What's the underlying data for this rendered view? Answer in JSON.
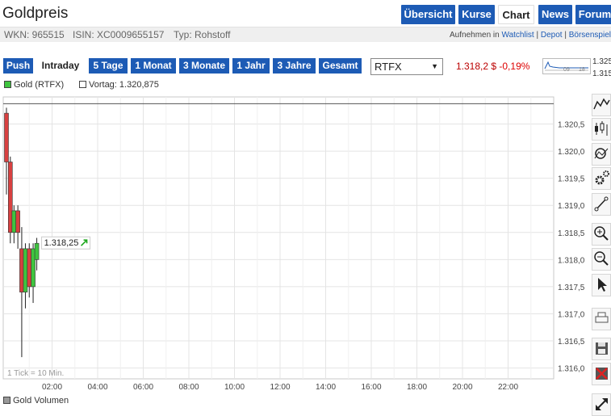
{
  "header": {
    "title": "Goldpreis",
    "tabs": [
      {
        "label": "Übersicht"
      },
      {
        "label": "Kurse"
      },
      {
        "label": "Chart"
      },
      {
        "label": "News"
      },
      {
        "label": "Forum"
      }
    ]
  },
  "info": {
    "wkn": "WKN: 965515",
    "isin": "ISIN: XC0009655157",
    "typ": "Typ: Rohstoff",
    "aufnehmen": "Aufnehmen in",
    "watchlist": "Watchlist",
    "sep1": "|",
    "depot": "Depot",
    "sep2": "|",
    "boersenspiel": "Börsenspiel"
  },
  "toolbar": {
    "ranges": [
      "Push",
      "Intraday",
      "5 Tage",
      "1 Monat",
      "3 Monate",
      "1 Jahr",
      "3 Jahre",
      "Gesamt"
    ],
    "exchange": "RTFX",
    "price": "1.318,2 $",
    "change": "-0,19%",
    "mini_labels": [
      "09",
      "18"
    ],
    "mini_values": [
      "1.325",
      "1.315"
    ]
  },
  "legend": {
    "gold": "Gold (RTFX)",
    "vortag": "Vortag: 1.320,875"
  },
  "chart_data": {
    "type": "candlestick",
    "y_ticks": [
      "1.320,5",
      "1.320,0",
      "1.319,5",
      "1.319,0",
      "1.318,5",
      "1.318,0",
      "1.317,5",
      "1.317,0",
      "1.316,5",
      "1.316,0"
    ],
    "y_tick_values": [
      1320.5,
      1320.0,
      1319.5,
      1319.0,
      1318.5,
      1318.0,
      1317.5,
      1317.0,
      1316.5,
      1316.0
    ],
    "x_ticks": [
      "02:00",
      "04:00",
      "06:00",
      "08:00",
      "10:00",
      "12:00",
      "14:00",
      "16:00",
      "18:00",
      "20:00",
      "22:00"
    ],
    "x_tick_hours": [
      2,
      4,
      6,
      8,
      10,
      12,
      14,
      16,
      18,
      20,
      22
    ],
    "ylim": [
      1315.8,
      1321.0
    ],
    "xlim_hours": [
      0.0,
      24.0
    ],
    "candles": [
      {
        "t": 0.0,
        "open": 1320.7,
        "high": 1320.8,
        "low": 1319.2,
        "close": 1319.8
      },
      {
        "t": 0.17,
        "open": 1319.8,
        "high": 1319.9,
        "low": 1318.3,
        "close": 1318.5
      },
      {
        "t": 0.33,
        "open": 1318.5,
        "high": 1319.0,
        "low": 1318.3,
        "close": 1318.9
      },
      {
        "t": 0.5,
        "open": 1318.9,
        "high": 1319.0,
        "low": 1318.2,
        "close": 1318.5
      },
      {
        "t": 0.67,
        "open": 1318.2,
        "high": 1318.6,
        "low": 1316.2,
        "close": 1317.4
      },
      {
        "t": 0.83,
        "open": 1317.4,
        "high": 1318.3,
        "low": 1317.1,
        "close": 1318.2
      },
      {
        "t": 1.0,
        "open": 1318.2,
        "high": 1318.3,
        "low": 1317.3,
        "close": 1317.5
      },
      {
        "t": 1.17,
        "open": 1317.5,
        "high": 1318.3,
        "low": 1317.2,
        "close": 1318.2
      },
      {
        "t": 1.33,
        "open": 1318.0,
        "high": 1318.4,
        "low": 1317.8,
        "close": 1318.3
      }
    ],
    "vortag": 1320.875,
    "last_label": "1.318,25",
    "tick_note": "1 Tick = 10 Min.",
    "colors": {
      "up": "#3fc43f",
      "down": "#d84040",
      "grid": "#e4e4e4"
    }
  },
  "volume": {
    "label": "Gold Volumen"
  }
}
